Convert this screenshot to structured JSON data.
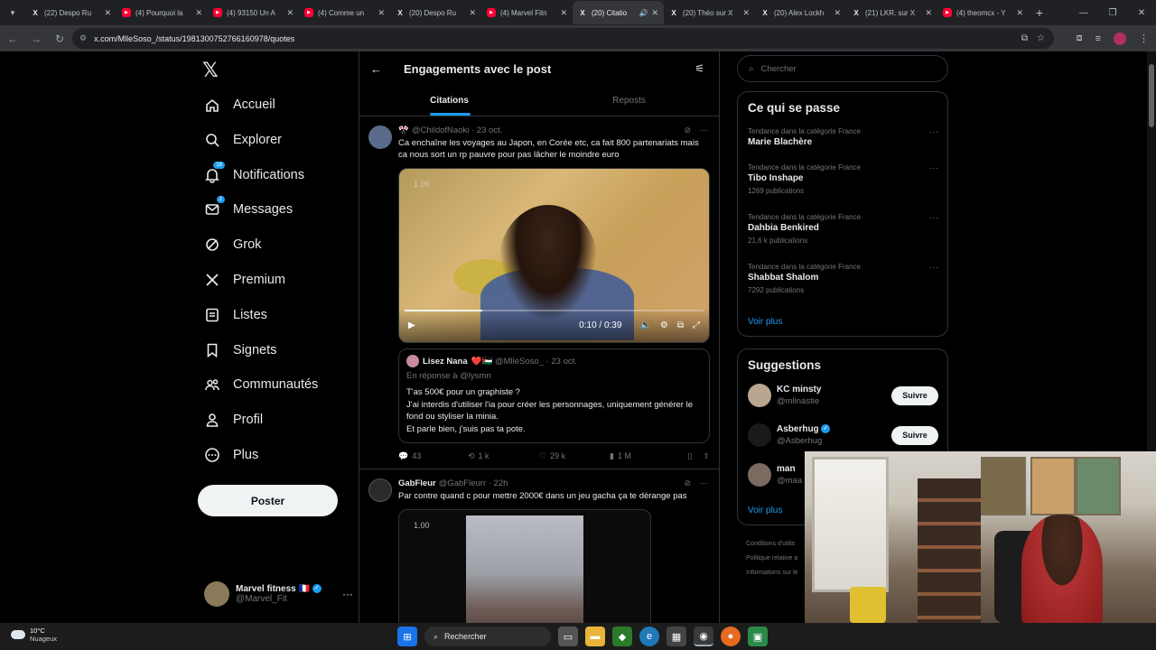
{
  "browser": {
    "tabs": [
      {
        "icon": "x",
        "title": "(22) Despo Ru"
      },
      {
        "icon": "yt",
        "title": "(4) Pourquoi la"
      },
      {
        "icon": "yt",
        "title": "(4) 93150 Un A"
      },
      {
        "icon": "yt",
        "title": "(4) Comme un"
      },
      {
        "icon": "x",
        "title": "(20) Despo Ru"
      },
      {
        "icon": "yt",
        "title": "(4) Marvel Fitn"
      },
      {
        "icon": "x",
        "title": "(20) Citatio",
        "active": true
      },
      {
        "icon": "x",
        "title": "(20) Théo sur X"
      },
      {
        "icon": "x",
        "title": "(20) Alex Lockh"
      },
      {
        "icon": "x",
        "title": "(21) LKR. sur X"
      },
      {
        "icon": "yt",
        "title": "(4) theomcx - Y"
      }
    ],
    "url": "x.com/MlleSoso_/status/1981300752766160978/quotes"
  },
  "nav": {
    "items": [
      {
        "label": "Accueil",
        "icon": "home-icon"
      },
      {
        "label": "Explorer",
        "icon": "search-icon"
      },
      {
        "label": "Notifications",
        "icon": "bell-icon",
        "badge": "18"
      },
      {
        "label": "Messages",
        "icon": "mail-icon",
        "badge": "2"
      },
      {
        "label": "Grok",
        "icon": "grok-icon"
      },
      {
        "label": "Premium",
        "icon": "x-logo-icon"
      },
      {
        "label": "Listes",
        "icon": "list-icon"
      },
      {
        "label": "Signets",
        "icon": "bookmark-icon"
      },
      {
        "label": "Communautés",
        "icon": "people-icon"
      },
      {
        "label": "Profil",
        "icon": "person-icon"
      },
      {
        "label": "Plus",
        "icon": "more-circle-icon"
      }
    ],
    "post_button": "Poster",
    "account": {
      "name": "Marvel fitness 🇫🇷",
      "handle": "@Marvel_Fit"
    }
  },
  "main": {
    "title": "Engagements avec le post",
    "tabs": [
      "Citations",
      "Reposts"
    ],
    "posts": [
      {
        "name": "🎌",
        "handle": "@ChildofNaoki",
        "date": "· 23 oct.",
        "text": "Ca enchaîne les voyages au Japon, en Corée etc, ca fait 800 partenariats mais ca nous sort un rp pauvre pour pas lâcher le moindre euro",
        "video": {
          "watermark": "1.00",
          "time": "0:10 / 0:39",
          "progress": 0.26
        },
        "quote": {
          "name": "Lisez Nana",
          "handle": "@MlleSoso_ · 23 oct.",
          "reply": "En réponse à @lysmn",
          "text": "T'as 500€ pour un graphiste ?\nJ'ai interdis d'utiliser l'ia pour créer les personnages, uniquement générer le fond ou styliser la minia.\nEt parle bien, j'suis pas ta pote."
        },
        "stats": {
          "replies": "43",
          "reposts": "1 k",
          "likes": "29 k",
          "views": "1 M"
        }
      },
      {
        "name": "GabFleur",
        "handle": "@GabFleurr · 22h",
        "text": "Par contre quand c pour mettre 2000€  dans un jeu gacha ça te dérange pas",
        "media_watermark": "1.00"
      }
    ]
  },
  "right": {
    "search_placeholder": "Chercher",
    "trends_title": "Ce qui se passe",
    "trends": [
      {
        "category": "Tendance dans la catégorie France",
        "name": "Marie Blachère",
        "count": ""
      },
      {
        "category": "Tendance dans la catégorie France",
        "name": "Tibo Inshape",
        "count": "1269 publications"
      },
      {
        "category": "Tendance dans la catégorie France",
        "name": "Dahbia Benkired",
        "count": "21,6 k publications"
      },
      {
        "category": "Tendance dans la catégorie France",
        "name": "Shabbat Shalom",
        "count": "7292 publications"
      }
    ],
    "see_more": "Voir plus",
    "suggestions_title": "Suggestions",
    "suggestions": [
      {
        "name": "KC minsty",
        "handle": "@mlinastie",
        "button": "Suivre"
      },
      {
        "name": "Asberhug",
        "handle": "@Asberhug",
        "button": "Suivre"
      },
      {
        "name": "man",
        "handle": "@maa",
        "button": ""
      }
    ],
    "suggestions_more": "Voir plus",
    "footer": [
      "Conditions d'utilis",
      "Politique relative a",
      "Informations sur le"
    ]
  },
  "taskbar": {
    "temperature": "10°C",
    "weather": "Nuageux",
    "search": "Rechercher"
  },
  "colors": {
    "accent": "#1d9bf0",
    "background": "#000000",
    "border": "#2f3336",
    "muted": "#71767b"
  }
}
